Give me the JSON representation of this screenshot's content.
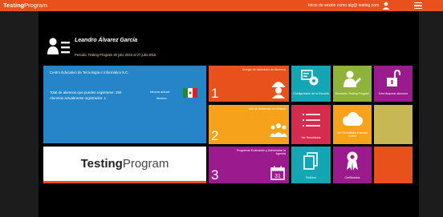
{
  "topbar": {
    "brand_bold": "Testing",
    "brand_light": "Program",
    "session_text": "Inicio de sesión como alg@ testing.com"
  },
  "profile": {
    "name": "Leandro Álvarez García",
    "period": "Periodo: Testing Program 20 julio 2015 al 27 julio 2015"
  },
  "info_panel": {
    "title": "Centro Educativo de Tecnología e Informática S.C.",
    "line1": "Total de alumnos que pueden registrarse: 250",
    "line2": "Alumnos actualmente registrados: 1",
    "language_label": "Idioma actual:",
    "language_value": "Mexico"
  },
  "logo": {
    "bold": "Testing",
    "light": "Program"
  },
  "tiles": {
    "t1": {
      "label": "Arreglo de calendario de Alumnos",
      "number": "1"
    },
    "t2": {
      "label": "Alta de Asistencia de Grupos",
      "number": "2"
    },
    "t3": {
      "label": "Programar Evaluación y Administrar la Agenda",
      "number": "3"
    },
    "config": {
      "label": "Configuración de la Escuela"
    },
    "directory": {
      "label": "Directorio Testing Program"
    },
    "unlock": {
      "label": "Des-bloquear alumnos"
    },
    "results": {
      "label": "Ver Resultados"
    },
    "cloud": {
      "label": "Ver Resultados Escuela Online"
    },
    "orders": {
      "label": "Pedidos"
    },
    "certificates": {
      "label": "Certificados"
    }
  },
  "colors": {
    "orange": "#e8501c",
    "blue": "#2585c8",
    "purple": "#9b1a8e",
    "teal": "#14a6b4",
    "amber": "#f7a21b",
    "green": "#8fb23a",
    "crimson": "#d42b4e",
    "olive": "#c7b755"
  }
}
